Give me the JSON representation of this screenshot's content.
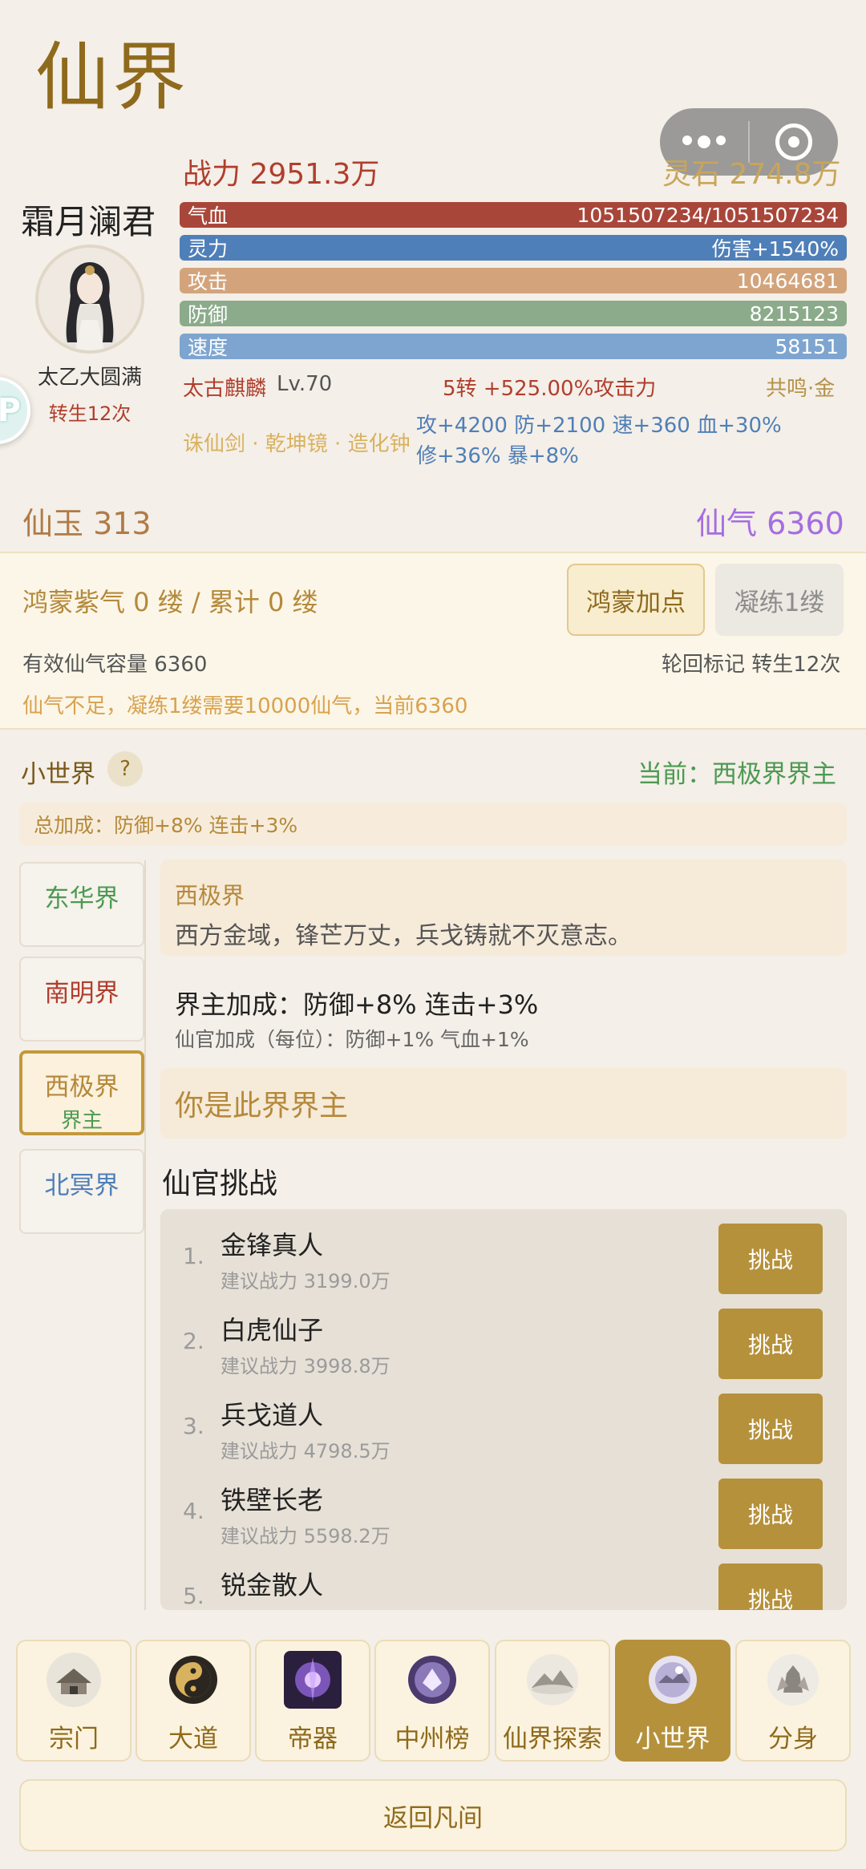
{
  "page": {
    "title": "仙界"
  },
  "stats": {
    "power_label": "战力 2951.3万",
    "stone_label": "灵石 274.8万"
  },
  "character": {
    "name": "霜月澜君",
    "realm": "太乙大圆满",
    "rebirth": "转生12次"
  },
  "bars": {
    "hp": {
      "label": "气血",
      "value": "1051507234/1051507234"
    },
    "sp": {
      "label": "灵力",
      "value": "伤害+1540%"
    },
    "atk": {
      "label": "攻击",
      "value": "10464681"
    },
    "def": {
      "label": "防御",
      "value": "8215123"
    },
    "spd": {
      "label": "速度",
      "value": "58151"
    }
  },
  "beast": {
    "name": "太古麒麟",
    "level": "Lv.70",
    "rebirth": "5转 +525.00%攻击力",
    "resonance": "共鸣·金"
  },
  "treasures": {
    "names": "诛仙剑 · 乾坤镜 · 造化钟",
    "stats_line1": "攻+4200 防+2100 速+360 血+30%",
    "stats_line2": "修+36% 暴+8%"
  },
  "currency": {
    "jade": "仙玉 313",
    "xianqi": "仙气 6360"
  },
  "hongmeng": {
    "text": "鸿蒙紫气 0 缕 / 累计 0 缕",
    "add_button": "鸿蒙加点",
    "refine_button": "凝练1缕",
    "capacity": "有效仙气容量 6360",
    "mark": "轮回标记 转生12次",
    "warning": "仙气不足，凝练1缕需要10000仙气，当前6360"
  },
  "small_world": {
    "title": "小世界",
    "help": "?",
    "current": "当前：西极界界主",
    "total_bonus": "总加成：防御+8%  连击+3%",
    "tabs": [
      {
        "label": "东华界",
        "color": "#4c9a52"
      },
      {
        "label": "南明界",
        "color": "#b03e2d"
      },
      {
        "label": "西极界",
        "sub": "界主",
        "color": "#b5893a"
      },
      {
        "label": "北冥界",
        "color": "#4f7fb8"
      }
    ],
    "world": {
      "name": "西极界",
      "desc": "西方金域，锋芒万丈，兵戈铸就不灭意志。",
      "lord_bonus": "界主加成：防御+8%  连击+3%",
      "official_bonus": "仙官加成（每位）：防御+1% 气血+1%",
      "lord_status": "你是此界界主"
    },
    "challenge_title": "仙官挑战",
    "challenges": [
      {
        "num": "1.",
        "name": "金锋真人",
        "power": "建议战力 3199.0万",
        "button": "挑战"
      },
      {
        "num": "2.",
        "name": "白虎仙子",
        "power": "建议战力 3998.8万",
        "button": "挑战"
      },
      {
        "num": "3.",
        "name": "兵戈道人",
        "power": "建议战力 4798.5万",
        "button": "挑战"
      },
      {
        "num": "4.",
        "name": "铁壁长老",
        "power": "建议战力 5598.2万",
        "button": "挑战"
      },
      {
        "num": "5.",
        "name": "锐金散人",
        "power": "",
        "button": "挑战"
      }
    ]
  },
  "nav": {
    "items": [
      {
        "label": "宗门",
        "icon": "sect-icon"
      },
      {
        "label": "大道",
        "icon": "taiji-icon"
      },
      {
        "label": "帝器",
        "icon": "emperor-artifact-icon"
      },
      {
        "label": "中州榜",
        "icon": "ranking-icon"
      },
      {
        "label": "仙界探索",
        "icon": "explore-icon"
      },
      {
        "label": "小世界",
        "icon": "small-world-icon"
      },
      {
        "label": "分身",
        "icon": "clone-icon"
      }
    ],
    "active_index": 5,
    "return_label": "返回凡间"
  }
}
